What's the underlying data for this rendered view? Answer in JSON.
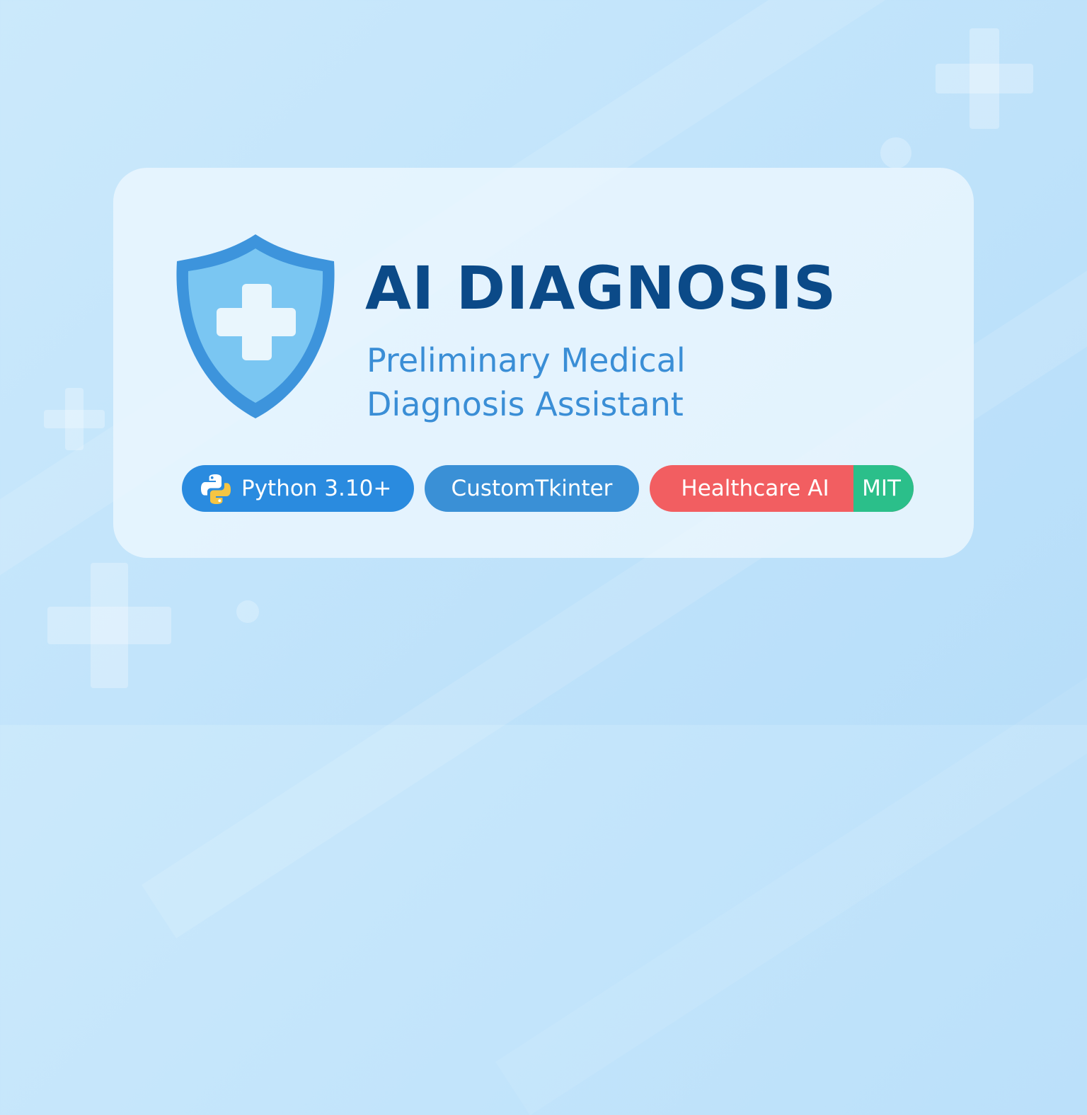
{
  "banner": {
    "title": "AI DIAGNOSIS",
    "subtitle_lines": [
      "Preliminary Medical",
      "Diagnosis Assistant"
    ],
    "logo_icon": "shield-medical-cross-icon"
  },
  "badges": {
    "python": {
      "label": "Python 3.10+",
      "icon": "python-logo-icon",
      "color": "#2a8bdf"
    },
    "customtkinter": {
      "label": "CustomTkinter",
      "color": "#3a90d6"
    },
    "healthcare_ai": {
      "label": "Healthcare AI",
      "color": "#f25e61"
    },
    "license": {
      "label": "MIT",
      "color": "#2bbf8a"
    }
  },
  "colors": {
    "title": "#0b4a88",
    "subtitle": "#3a8ed6",
    "background": "#c2e4fb",
    "shield_outer": "#3d94dc",
    "shield_inner": "#7ac6f2"
  }
}
